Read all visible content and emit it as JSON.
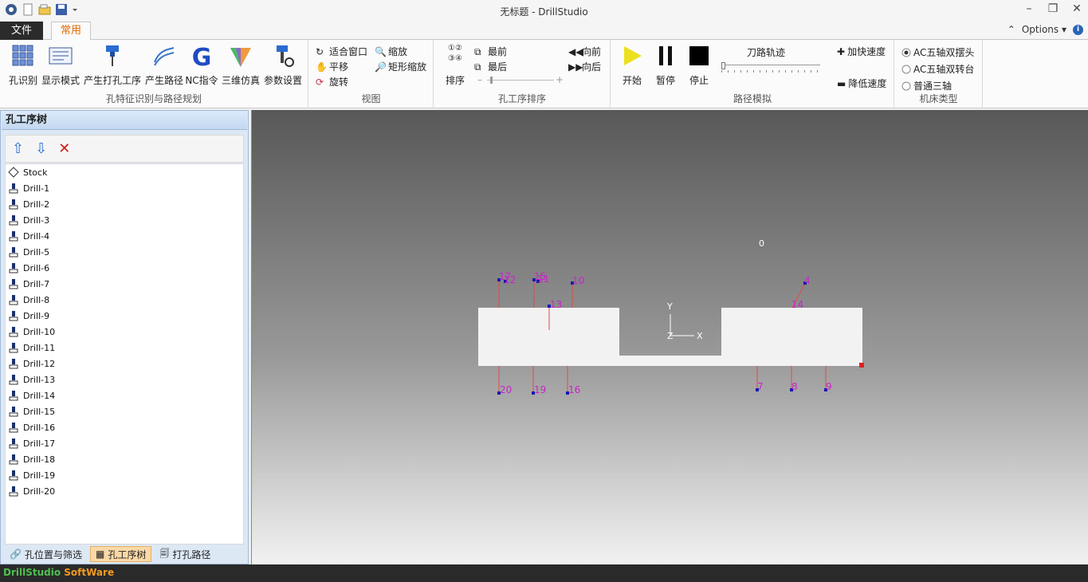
{
  "window": {
    "title": "无标题 - DrillStudio"
  },
  "ribbon_tabs": {
    "file": "文件",
    "home": "常用",
    "options": "Options"
  },
  "groups": {
    "recognition": {
      "label": "孔特征识别与路径规划",
      "buttons": [
        "孔识别",
        "显示模式",
        "产生打孔工序",
        "产生路径",
        "NC指令",
        "三维仿真",
        "参数设置"
      ]
    },
    "view": {
      "label": "视图",
      "buttons": [
        "适合窗口",
        "缩放",
        "平移",
        "矩形缩放",
        "旋转"
      ]
    },
    "order": {
      "label": "孔工序排序",
      "sort": "排序",
      "first": "最前",
      "last": "最后",
      "forward": "向前",
      "backward": "向后"
    },
    "sim": {
      "label": "路径模拟",
      "start": "开始",
      "pause": "暂停",
      "stop": "停止",
      "track": "刀路轨迹",
      "faster": "加快速度",
      "slower": "降低速度"
    },
    "machine": {
      "label": "机床类型",
      "options": [
        "AC五轴双摆头",
        "AC五轴双转台",
        "普通三轴"
      ],
      "selected": "AC五轴双摆头"
    }
  },
  "panel": {
    "title": "孔工序树",
    "items": [
      "Stock",
      "Drill-1",
      "Drill-2",
      "Drill-3",
      "Drill-4",
      "Drill-5",
      "Drill-6",
      "Drill-7",
      "Drill-8",
      "Drill-9",
      "Drill-10",
      "Drill-11",
      "Drill-12",
      "Drill-13",
      "Drill-14",
      "Drill-15",
      "Drill-16",
      "Drill-17",
      "Drill-18",
      "Drill-19",
      "Drill-20"
    ],
    "tabs": [
      "孔位置与筛选",
      "孔工序树",
      "打孔路径"
    ],
    "active_tab": "孔工序树"
  },
  "viewport": {
    "origin_label": "0",
    "axis_y": "Y",
    "axis_x": "X",
    "axis_z": "Z",
    "hole_labels": [
      "17",
      "12",
      "15",
      "11",
      "10",
      "13",
      "14",
      "4",
      "20",
      "19",
      "16",
      "7",
      "8",
      "9"
    ]
  },
  "status": {
    "brand1": "DrillStudio",
    "brand2": "SoftWare"
  },
  "colors": {
    "accent": "#e06a00",
    "hole_label": "#cc22cc",
    "drill_line": "#e04a4a",
    "hole_point": "#1a1ab0"
  }
}
